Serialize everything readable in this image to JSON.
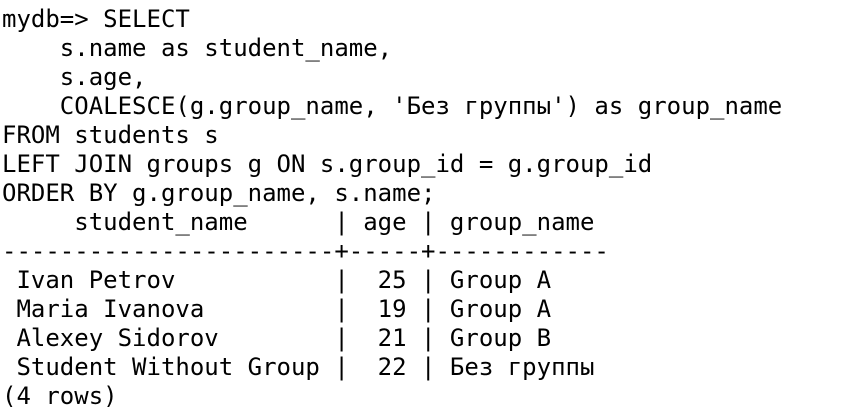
{
  "terminal": {
    "lines": [
      "mydb=> SELECT",
      "    s.name as student_name,",
      "    s.age,",
      "    COALESCE(g.group_name, 'Без группы') as group_name",
      "FROM students s",
      "LEFT JOIN groups g ON s.group_id = g.group_id",
      "ORDER BY g.group_name, s.name;",
      "     student_name      | age | group_name",
      "-----------------------+-----+------------",
      " Ivan Petrov           |  25 | Group A",
      " Maria Ivanova         |  19 | Group A",
      " Alexey Sidorov        |  21 | Group B",
      " Student Without Group |  22 | Без группы",
      "(4 rows)"
    ]
  }
}
